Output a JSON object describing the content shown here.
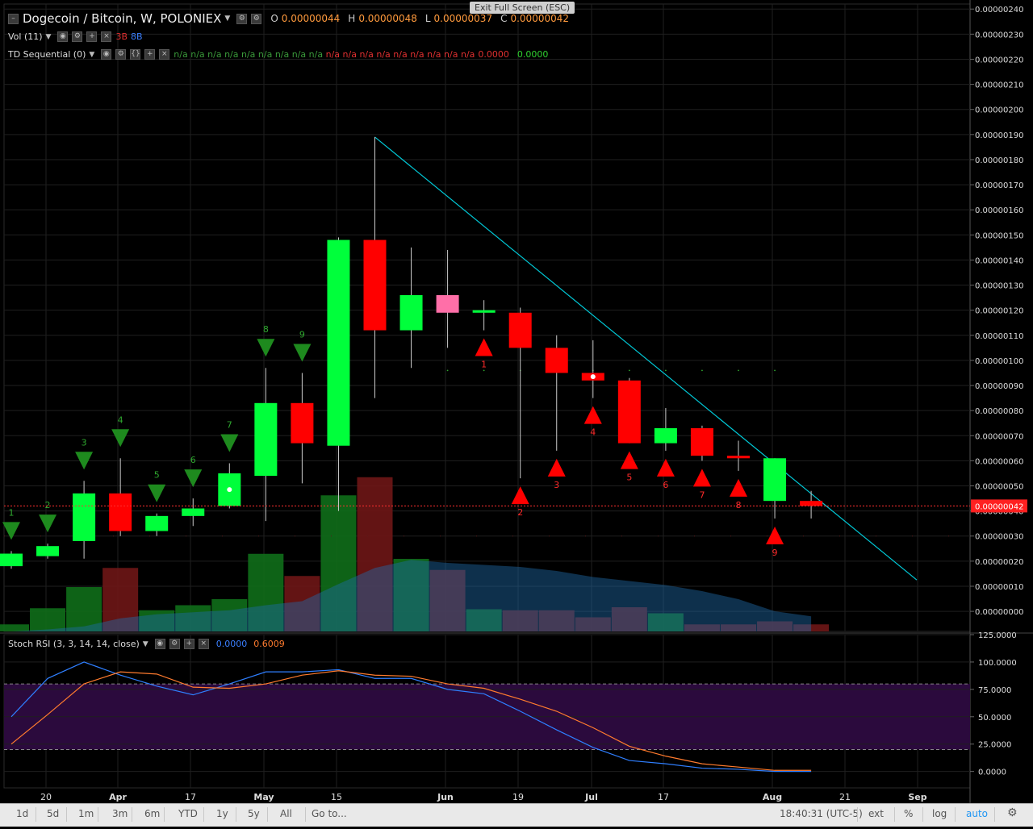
{
  "header": {
    "symbol": "Dogecoin / Bitcoin, W, POLONIEX",
    "o_label": "O",
    "o": "0.00000044",
    "h_label": "H",
    "h": "0.00000048",
    "l_label": "L",
    "l": "0.00000037",
    "c_label": "C",
    "c": "0.00000042",
    "exit_fullscreen": "Exit Full Screen (ESC)"
  },
  "vol_legend": {
    "label": "Vol (11)",
    "v1": "3B",
    "v2": "8B"
  },
  "td_legend": {
    "label": "TD Sequential (0)",
    "na_green": [
      "n/a",
      "n/a",
      "n/a",
      "n/a",
      "n/a",
      "n/a",
      "n/a",
      "n/a",
      "n/a"
    ],
    "na_red": [
      "n/a",
      "n/a",
      "n/a",
      "n/a",
      "n/a",
      "n/a",
      "n/a",
      "n/a",
      "n/a"
    ],
    "v1": "0.0000",
    "v2": "0.0000"
  },
  "stoch_legend": {
    "label": "Stoch RSI (3, 3, 14, 14, close)",
    "k": "0.0000",
    "d": "0.6009"
  },
  "colors": {
    "up": "#00ff3b",
    "down": "#ff0000",
    "doji_pink": "#ff6fa8",
    "trendline": "#00c8d6",
    "stoch_k": "#2f7fff",
    "stoch_d": "#ff7b2e",
    "band": "#2b0a3d",
    "vol_up": "#0f6e1a",
    "vol_down": "#6e1616",
    "td_green": "#1e8a1e",
    "td_red": "#ff0000",
    "grid": "#1f1f1f"
  },
  "footer": {
    "ranges": [
      "1d",
      "5d",
      "1m",
      "3m",
      "6m",
      "YTD",
      "1y",
      "5y",
      "All"
    ],
    "goto": "Go to...",
    "time": "18:40:31 (UTC-5)",
    "right": [
      "ext",
      "%",
      "log",
      "auto"
    ]
  },
  "chart_data": [
    {
      "type": "candlestick",
      "title": "Dogecoin / Bitcoin, W, POLONIEX",
      "x_tick_labels": [
        "20",
        "Apr",
        "17",
        "May",
        "15",
        "Jun",
        "19",
        "Jul",
        "17",
        "Aug",
        "21",
        "Sep"
      ],
      "y_tick_labels": [
        "0.00000000",
        "0.00000010",
        "0.00000020",
        "0.00000030",
        "0.00000040",
        "0.00000050",
        "0.00000060",
        "0.00000070",
        "0.00000080",
        "0.00000090",
        "0.00000100",
        "0.00000110",
        "0.00000120",
        "0.00000130",
        "0.00000140",
        "0.00000150",
        "0.00000160",
        "0.00000170",
        "0.00000180",
        "0.00000190",
        "0.00000200",
        "0.00000210",
        "0.00000220",
        "0.00000230",
        "0.00000240"
      ],
      "ylim": [
        -8e-08,
        2.42e-06
      ],
      "y_unit_scale": 1e-08,
      "last_price_label": "0.00000042",
      "candles_x8": [
        {
          "o": 18,
          "h": 24,
          "l": 17,
          "c": 23
        },
        {
          "o": 22,
          "h": 27,
          "l": 21,
          "c": 26
        },
        {
          "o": 28,
          "h": 52,
          "l": 21,
          "c": 47
        },
        {
          "o": 47,
          "h": 61,
          "l": 30,
          "c": 32
        },
        {
          "o": 32,
          "h": 39,
          "l": 30,
          "c": 38
        },
        {
          "o": 38,
          "h": 45,
          "l": 34,
          "c": 41
        },
        {
          "o": 42,
          "h": 59,
          "l": 41,
          "c": 55
        },
        {
          "o": 54,
          "h": 97,
          "l": 36,
          "c": 83
        },
        {
          "o": 83,
          "h": 95,
          "l": 51,
          "c": 67
        },
        {
          "o": 66,
          "h": 149,
          "l": 40,
          "c": 148
        },
        {
          "o": 148,
          "h": 189,
          "l": 85,
          "c": 112
        },
        {
          "o": 112,
          "h": 145,
          "l": 97,
          "c": 126
        },
        {
          "o": 126,
          "h": 144,
          "l": 105,
          "c": 119
        },
        {
          "o": 119,
          "h": 124,
          "l": 112,
          "c": 120
        },
        {
          "o": 119,
          "h": 121,
          "l": 53,
          "c": 105
        },
        {
          "o": 105,
          "h": 110,
          "l": 64,
          "c": 95
        },
        {
          "o": 95,
          "h": 108,
          "l": 85,
          "c": 92
        },
        {
          "o": 92,
          "h": 93,
          "l": 67,
          "c": 67
        },
        {
          "o": 67,
          "h": 81,
          "l": 64,
          "c": 73
        },
        {
          "o": 73,
          "h": 74,
          "l": 60,
          "c": 62
        },
        {
          "o": 62,
          "h": 68,
          "l": 56,
          "c": 61
        },
        {
          "o": 44,
          "h": 61,
          "l": 37,
          "c": 61
        },
        {
          "o": 44,
          "h": 48,
          "l": 37,
          "c": 42
        }
      ],
      "td_sell_setup": [
        {
          "bar": 0,
          "label": "1"
        },
        {
          "bar": 1,
          "label": "2"
        },
        {
          "bar": 2,
          "label": "3"
        },
        {
          "bar": 3,
          "label": "4"
        },
        {
          "bar": 4,
          "label": "5"
        },
        {
          "bar": 5,
          "label": "6"
        },
        {
          "bar": 6,
          "label": "7"
        },
        {
          "bar": 7,
          "label": "8"
        },
        {
          "bar": 8,
          "label": "9"
        }
      ],
      "td_buy_setup": [
        {
          "bar": 13,
          "label": "1"
        },
        {
          "bar": 14,
          "label": "2"
        },
        {
          "bar": 15,
          "label": "3"
        },
        {
          "bar": 16,
          "label": "4"
        },
        {
          "bar": 17,
          "label": "5"
        },
        {
          "bar": 18,
          "label": "6"
        },
        {
          "bar": 19,
          "label": "7"
        },
        {
          "bar": 20,
          "label": "8"
        },
        {
          "bar": 21,
          "label": "9"
        }
      ],
      "volume_rel": [
        {
          "v": 0.07,
          "up": true
        },
        {
          "v": 0.23,
          "up": true
        },
        {
          "v": 0.44,
          "up": true
        },
        {
          "v": 0.63,
          "up": false
        },
        {
          "v": 0.21,
          "up": true
        },
        {
          "v": 0.26,
          "up": true
        },
        {
          "v": 0.32,
          "up": true
        },
        {
          "v": 0.77,
          "up": true
        },
        {
          "v": 0.55,
          "up": false
        },
        {
          "v": 1.35,
          "up": true
        },
        {
          "v": 1.53,
          "up": false
        },
        {
          "v": 0.72,
          "up": true
        },
        {
          "v": 0.61,
          "up": false
        },
        {
          "v": 0.22,
          "up": true
        },
        {
          "v": 0.21,
          "up": false
        },
        {
          "v": 0.21,
          "up": false
        },
        {
          "v": 0.14,
          "up": false
        },
        {
          "v": 0.24,
          "up": false
        },
        {
          "v": 0.18,
          "up": true
        },
        {
          "v": 0.07,
          "up": false
        },
        {
          "v": 0.07,
          "up": false
        },
        {
          "v": 0.1,
          "up": false
        },
        {
          "v": 0.07,
          "up": false
        }
      ],
      "volume_ma_rel": [
        0.0,
        0.02,
        0.05,
        0.13,
        0.17,
        0.19,
        0.21,
        0.26,
        0.3,
        0.47,
        0.63,
        0.71,
        0.68,
        0.66,
        0.64,
        0.6,
        0.54,
        0.5,
        0.46,
        0.4,
        0.32,
        0.2,
        0.15
      ]
    },
    {
      "type": "line",
      "title": "Stoch RSI (3, 3, 14, 14, close)",
      "y_tick_labels": [
        "0.0000",
        "25.0000",
        "50.0000",
        "75.0000",
        "100.0000",
        "125.0000"
      ],
      "ylim": [
        -15,
        125
      ],
      "bands": [
        20,
        80
      ],
      "series": [
        {
          "name": "K",
          "values": [
            50,
            85,
            100,
            88,
            78,
            70,
            80,
            91,
            91,
            93,
            85,
            85,
            75,
            71,
            55,
            38,
            22,
            10,
            7,
            3,
            2,
            0,
            0
          ]
        },
        {
          "name": "D",
          "values": [
            25,
            52,
            80,
            91,
            89,
            77,
            76,
            80,
            88,
            92,
            88,
            87,
            80,
            76,
            66,
            55,
            40,
            23,
            14,
            7,
            4,
            1,
            1
          ]
        }
      ]
    }
  ]
}
